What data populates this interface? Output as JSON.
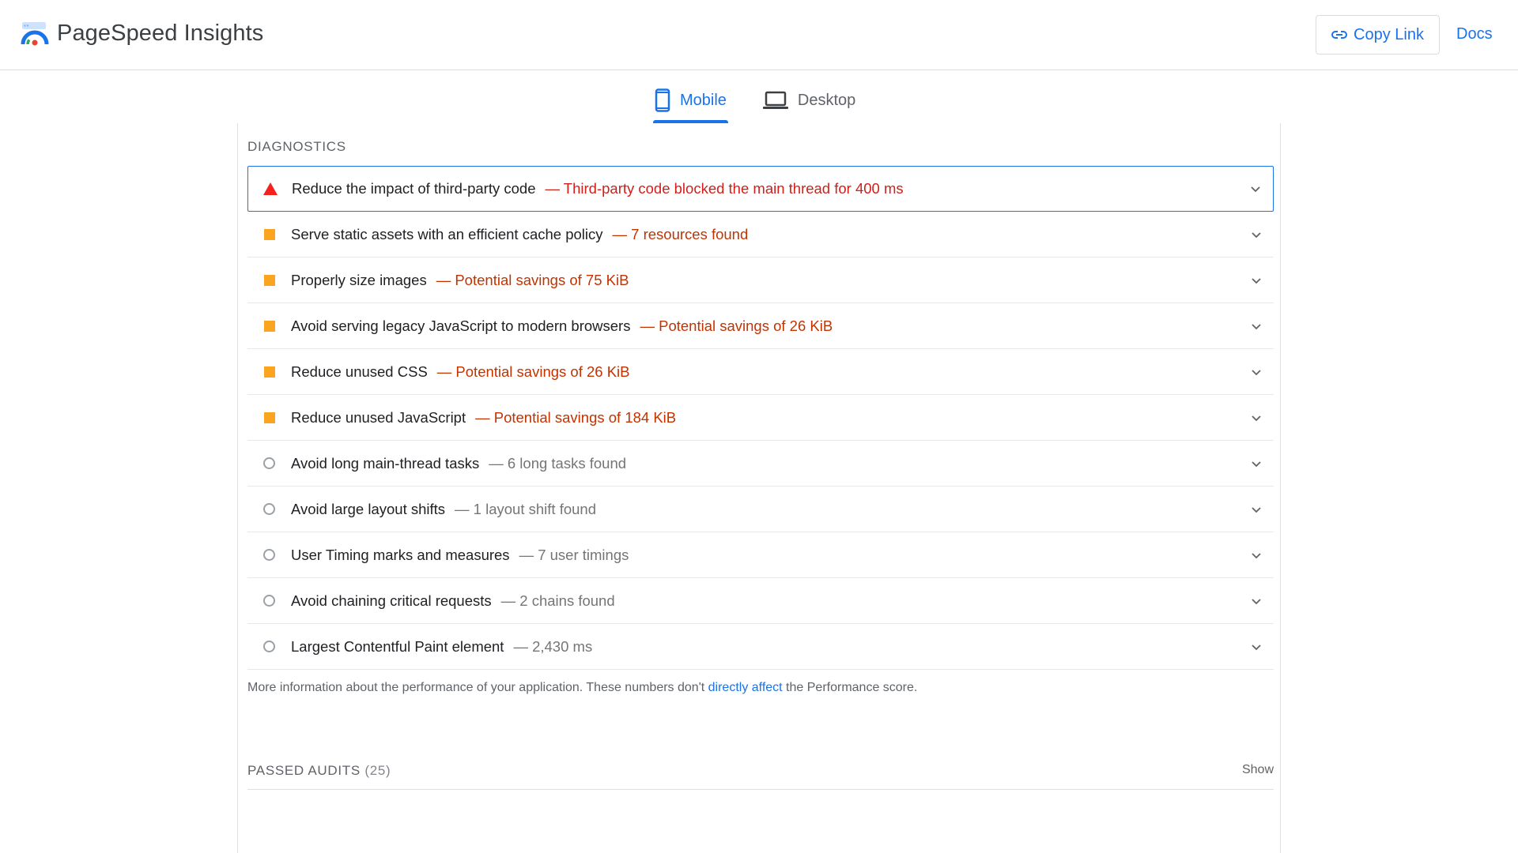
{
  "header": {
    "app_name": "PageSpeed Insights",
    "copy_link_label": "Copy Link",
    "docs_label": "Docs"
  },
  "tabs": [
    {
      "label": "Mobile",
      "active": true
    },
    {
      "label": "Desktop",
      "active": false
    }
  ],
  "diagnostics": {
    "title": "DIAGNOSTICS",
    "audits": [
      {
        "severity": "fail",
        "title": "Reduce the impact of third-party code",
        "detail": "— Third-party code blocked the main thread for 400 ms"
      },
      {
        "severity": "average",
        "title": "Serve static assets with an efficient cache policy",
        "detail": "— 7 resources found"
      },
      {
        "severity": "average",
        "title": "Properly size images",
        "detail": "— Potential savings of 75 KiB"
      },
      {
        "severity": "average",
        "title": "Avoid serving legacy JavaScript to modern browsers",
        "detail": "— Potential savings of 26 KiB"
      },
      {
        "severity": "average",
        "title": "Reduce unused CSS",
        "detail": "— Potential savings of 26 KiB"
      },
      {
        "severity": "average",
        "title": "Reduce unused JavaScript",
        "detail": "— Potential savings of 184 KiB"
      },
      {
        "severity": "info",
        "title": "Avoid long main-thread tasks",
        "detail": "— 6 long tasks found"
      },
      {
        "severity": "info",
        "title": "Avoid large layout shifts",
        "detail": "— 1 layout shift found"
      },
      {
        "severity": "info",
        "title": "User Timing marks and measures",
        "detail": "— 7 user timings"
      },
      {
        "severity": "info",
        "title": "Avoid chaining critical requests",
        "detail": "— 2 chains found"
      },
      {
        "severity": "info",
        "title": "Largest Contentful Paint element",
        "detail": "— 2,430 ms"
      }
    ],
    "info_prefix": "More information about the performance of your application. These numbers don't ",
    "info_link": "directly affect",
    "info_suffix": " the Performance score."
  },
  "passed_audits": {
    "title": "PASSED AUDITS",
    "count": "(25)",
    "show_label": "Show"
  },
  "colors": {
    "accent": "#1a73e8",
    "fail": "#f4211f",
    "average": "#fba420",
    "info": "#9aa0a6"
  }
}
